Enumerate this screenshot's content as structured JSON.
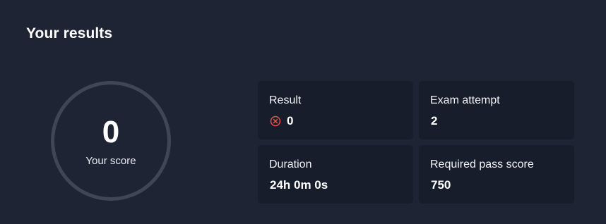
{
  "header": {
    "title": "Your results"
  },
  "score": {
    "value": "0",
    "label": "Your score"
  },
  "cards": {
    "result": {
      "label": "Result",
      "value": "0",
      "icon": "fail-circle-x-icon",
      "icon_color": "#e5534b"
    },
    "attempt": {
      "label": "Exam attempt",
      "value": "2"
    },
    "duration": {
      "label": "Duration",
      "value": "24h 0m 0s"
    },
    "pass_score": {
      "label": "Required pass score",
      "value": "750"
    }
  },
  "colors": {
    "background": "#1e2434",
    "card_background": "#181d2b",
    "ring": "#3f4656",
    "fail": "#e5534b"
  }
}
